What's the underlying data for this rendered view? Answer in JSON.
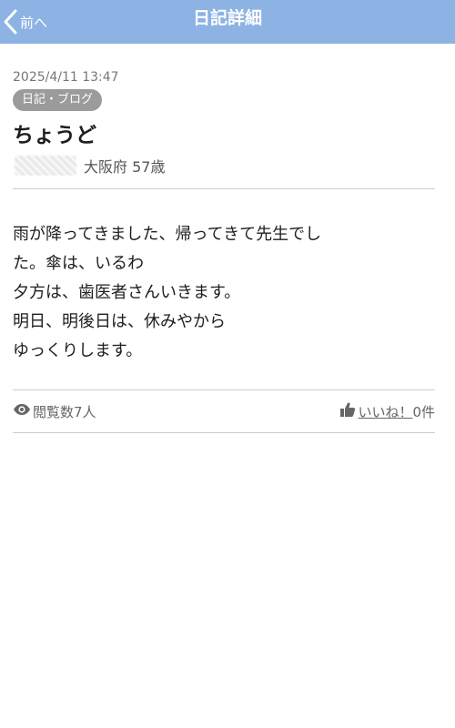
{
  "header": {
    "back_label": "前へ",
    "title": "日記詳細",
    "color": "#8cb3e3"
  },
  "post": {
    "datetime": "2025/4/11 13:47",
    "category": "日記・ブログ",
    "title": "ちょうど",
    "author_location_age": "大阪府 57歳",
    "body": "雨が降ってきました、帰ってきて先生でし\nた。傘は、いるわ\n夕方は、歯医者さんいきます。\n明日、明後日は、休みやから\nゆっくりします。"
  },
  "footer": {
    "views_label": "閲覧数7人",
    "like_label": "いいね！",
    "like_count": "0件"
  },
  "icons": {
    "back": "chevron-left-icon",
    "views": "eye-icon",
    "like": "thumbs-up-icon"
  }
}
